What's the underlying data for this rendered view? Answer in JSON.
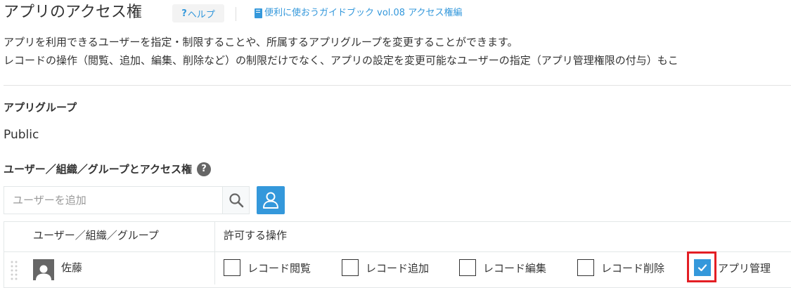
{
  "header": {
    "title": "アプリのアクセス権",
    "help_q": "?",
    "help_label": "ヘルプ",
    "guide_link": "便利に使おうガイドブック vol.08 アクセス権編"
  },
  "description": {
    "line1": "アプリを利用できるユーザーを指定・制限することや、所属するアプリグループを変更することができます。",
    "line2": "レコードの操作（閲覧、追加、編集、削除など）の制限だけでなく、アプリの設定を変更可能なユーザーの指定（アプリ管理権限の付与）もこ"
  },
  "app_group": {
    "heading": "アプリグループ",
    "value": "Public"
  },
  "access": {
    "heading": "ユーザー／組織／グループとアクセス権",
    "help_icon": "?",
    "search_placeholder": "ユーザーを追加",
    "table": {
      "col1": "ユーザー／組織／グループ",
      "col2": "許可する操作",
      "rows": [
        {
          "name": "佐藤",
          "permissions": [
            {
              "label": "レコード閲覧",
              "checked": false
            },
            {
              "label": "レコード追加",
              "checked": false
            },
            {
              "label": "レコード編集",
              "checked": false
            },
            {
              "label": "レコード削除",
              "checked": false
            },
            {
              "label": "アプリ管理",
              "checked": true
            }
          ]
        }
      ]
    }
  },
  "colors": {
    "accent": "#3498db",
    "highlight": "#e31e24",
    "text": "#333333"
  }
}
